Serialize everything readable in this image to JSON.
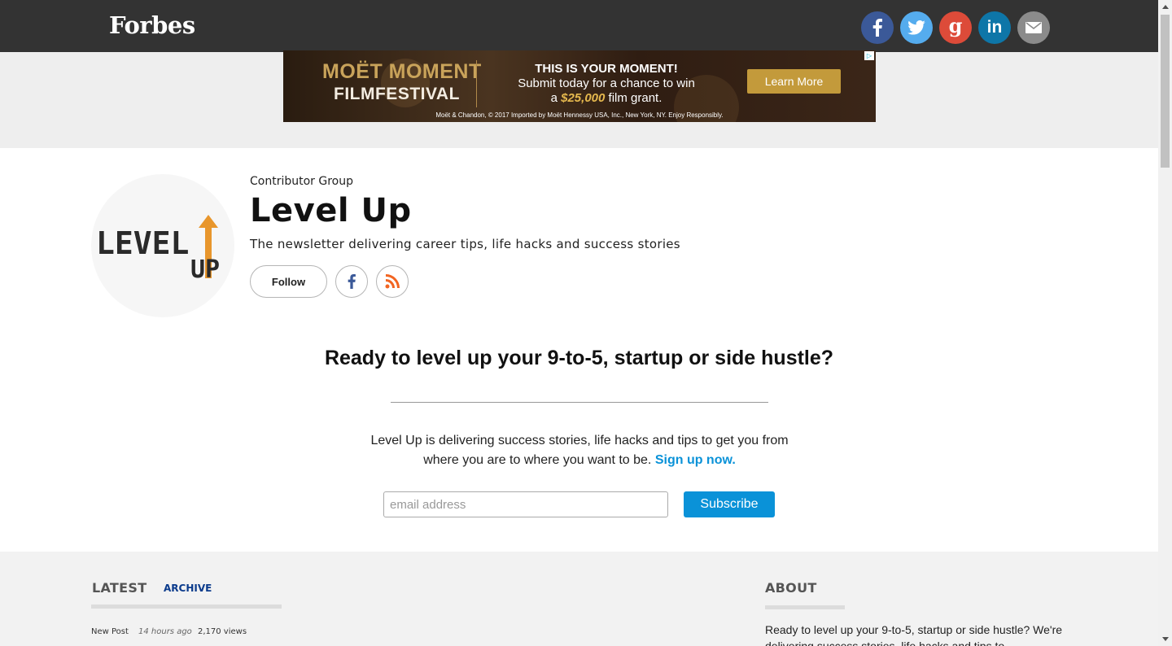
{
  "header": {
    "logo": "Forbes",
    "share_buttons": [
      {
        "name": "facebook-share",
        "icon": "facebook-icon",
        "color": "#3b5998"
      },
      {
        "name": "twitter-share",
        "icon": "twitter-icon",
        "color": "#55acee"
      },
      {
        "name": "google-plus-share",
        "icon": "google-plus-icon",
        "color": "#dd4b39"
      },
      {
        "name": "linkedin-share",
        "icon": "linkedin-icon",
        "color": "#0e76a8"
      },
      {
        "name": "email-share",
        "icon": "mail-icon",
        "color": "#8b8b8b"
      }
    ],
    "gplus_glyph": "g",
    "linkedin_glyph": "in"
  },
  "ad": {
    "brand_line1": "MOËT MOMENT",
    "brand_line2": "FILMFESTIVAL",
    "headline": "THIS IS YOUR MOMENT!",
    "sub_line1": "Submit today for a chance to win",
    "sub_line2_prefix": "a ",
    "sub_line2_amount": "$25,000",
    "sub_line2_suffix": " film grant.",
    "cta": "Learn More",
    "fine_print": "Moët & Chandon, © 2017 Imported by Moët Hennessy USA, Inc., New York, NY. Enjoy Responsibly.",
    "adchoices_glyph": "▷"
  },
  "profile": {
    "group_label": "Contributor Group",
    "title": "Level Up",
    "tagline": "The newsletter delivering career tips, life hacks and success stories",
    "logo_text_level": "LEVEL",
    "logo_text_up": "UP",
    "follow_label": "Follow"
  },
  "signup": {
    "heading": "Ready to level up your 9-to-5, startup or side hustle?",
    "body_line1": "Level Up is delivering success stories, life hacks and tips to get you from",
    "body_line2": "where you are to where you want to be.",
    "link": "Sign up now.",
    "email_placeholder": "email address",
    "email_value": "",
    "subscribe_label": "Subscribe"
  },
  "content": {
    "tabs": [
      {
        "label": "LATEST",
        "active": true
      },
      {
        "label": "ARCHIVE",
        "active": false
      }
    ],
    "post_meta": {
      "type": "New Post",
      "time": "14 hours ago",
      "views": "2,170 views"
    }
  },
  "sidebar": {
    "about_heading": "ABOUT",
    "about_text": "Ready to level up your 9-to-5, startup or side hustle? We're delivering success stories, life hacks and tips to"
  },
  "colors": {
    "topbar": "#333333",
    "accent_blue": "#0a92d8",
    "archive_blue": "#0b3b8c",
    "logo_orange": "#e8962c"
  }
}
